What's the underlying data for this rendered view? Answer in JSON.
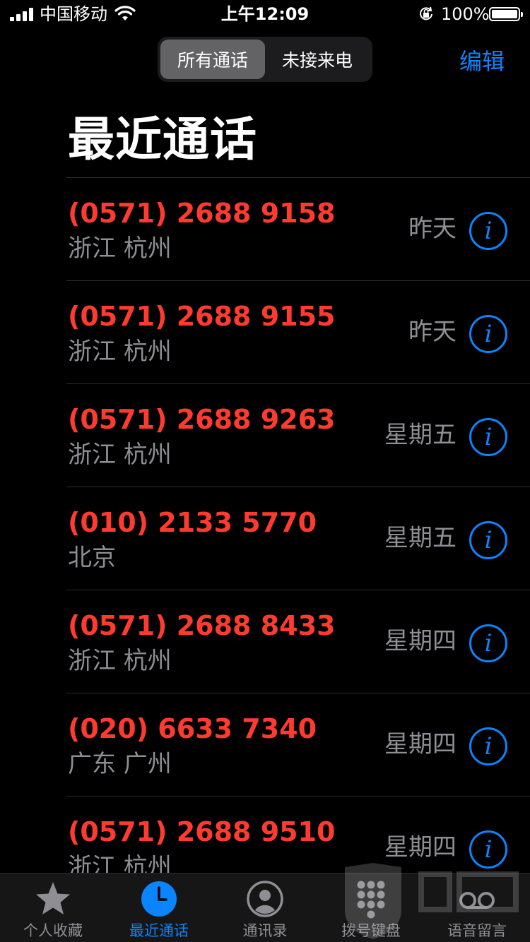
{
  "status_bar": {
    "carrier": "中国移动",
    "time": "上午12:09",
    "battery": "100%"
  },
  "segmented_control": {
    "all_label": "所有通话",
    "missed_label": "未接来电"
  },
  "header": {
    "edit_label": "编辑",
    "title": "最近通话"
  },
  "calls": [
    {
      "number": "(0571) 2688 9158",
      "location": "浙江 杭州",
      "date": "昨天"
    },
    {
      "number": "(0571) 2688 9155",
      "location": "浙江 杭州",
      "date": "昨天"
    },
    {
      "number": "(0571) 2688 9263",
      "location": "浙江 杭州",
      "date": "星期五"
    },
    {
      "number": "(010) 2133 5770",
      "location": "北京",
      "date": "星期五"
    },
    {
      "number": "(0571) 2688 8433",
      "location": "浙江 杭州",
      "date": "星期四"
    },
    {
      "number": "(020) 6633 7340",
      "location": "广东 广州",
      "date": "星期四"
    },
    {
      "number": "(0571) 2688 9510",
      "location": "浙江 杭州",
      "date": "星期四"
    }
  ],
  "tab_bar": {
    "favorites": "个人收藏",
    "recents": "最近通话",
    "contacts": "通讯录",
    "keypad": "拨号键盘",
    "voicemail": "语音留言"
  },
  "colors": {
    "missed_red": "#ff3b30",
    "accent_blue": "#0a84ff",
    "secondary_gray": "#8e8e93"
  },
  "icons": [
    "signal-bars-icon",
    "wifi-icon",
    "orientation-lock-icon",
    "battery-icon",
    "info-icon",
    "star-icon",
    "clock-icon",
    "person-circle-icon",
    "keypad-icon",
    "voicemail-icon"
  ]
}
